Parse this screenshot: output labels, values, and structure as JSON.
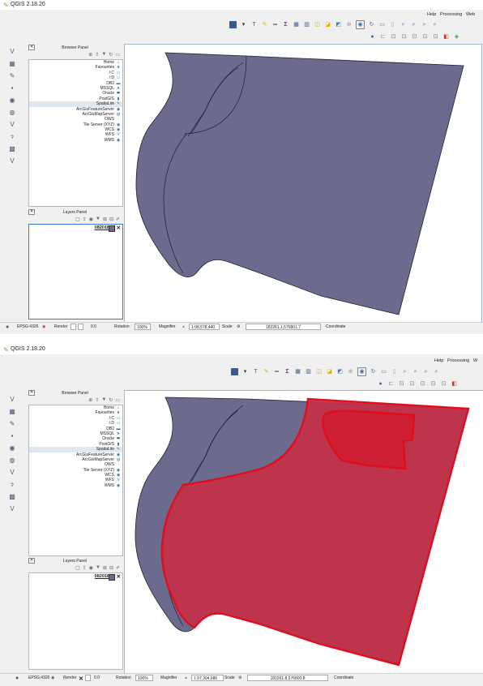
{
  "colors": {
    "polygon_fill": "#6c6b8e",
    "selection_fill": "#c43047",
    "selection_stroke": "#e00d1e",
    "app_icon": "#7aa33a"
  },
  "window": {
    "title": "QGIS 2.18.20"
  },
  "menu": {
    "help": "Help",
    "processing": "Processing",
    "web": "Web",
    "web_short": "W"
  },
  "browser_panel": {
    "title": "Browser Panel",
    "items": [
      {
        "label": "Home",
        "icon": "home-folder-icon"
      },
      {
        "label": "Favourites",
        "icon": "star-icon"
      },
      {
        "label": "/:C",
        "icon": "drive-icon"
      },
      {
        "label": "/:D",
        "icon": "drive-icon"
      },
      {
        "label": "DB2",
        "icon": "db2-icon"
      },
      {
        "label": "MSSQL",
        "icon": "mssql-icon"
      },
      {
        "label": "Oracle",
        "icon": "oracle-icon"
      },
      {
        "label": "PostGIS",
        "icon": "postgis-icon"
      },
      {
        "label": "SpatiaLite",
        "icon": "spatialite-icon"
      },
      {
        "label": "ArcGisFeatureServer",
        "icon": "arcgis-feature-icon"
      },
      {
        "label": "ArcGisMapServer",
        "icon": "arcgis-map-icon"
      },
      {
        "label": "OWS",
        "icon": "ows-icon"
      },
      {
        "label": "Tile Server (XYZ)",
        "icon": "xyz-icon"
      },
      {
        "label": "WCS",
        "icon": "wcs-icon"
      },
      {
        "label": "WFS",
        "icon": "wfs-icon"
      },
      {
        "label": "WMS",
        "icon": "wms-icon"
      }
    ]
  },
  "layers_panel": {
    "title": "Layers Panel",
    "layer_name": "082018"
  },
  "shot1": {
    "status": {
      "crs": "EPSG:4326",
      "render": "Render",
      "rotation_label": "Rotation",
      "rotation_value": "0.0",
      "magnifier_label": "Magnifier",
      "magnifier_value": "100%",
      "scale_label": "Scale",
      "scale_value": "1:98,578,440",
      "coordinate_value": "182261.1,576801.7",
      "coordinate_label": "Coordinate"
    }
  },
  "shot2": {
    "status": {
      "crs": "EPSG:4326",
      "render": "Render",
      "rotation_label": "Rotation",
      "rotation_value": "0.0",
      "magnifier_label": "Magnifier",
      "magnifier_value": "100%",
      "scale_label": "Scale",
      "scale_value": "1:97,304,686",
      "coordinate_value": "182261.8,576800.8",
      "coordinate_label": "Coordinate"
    }
  }
}
